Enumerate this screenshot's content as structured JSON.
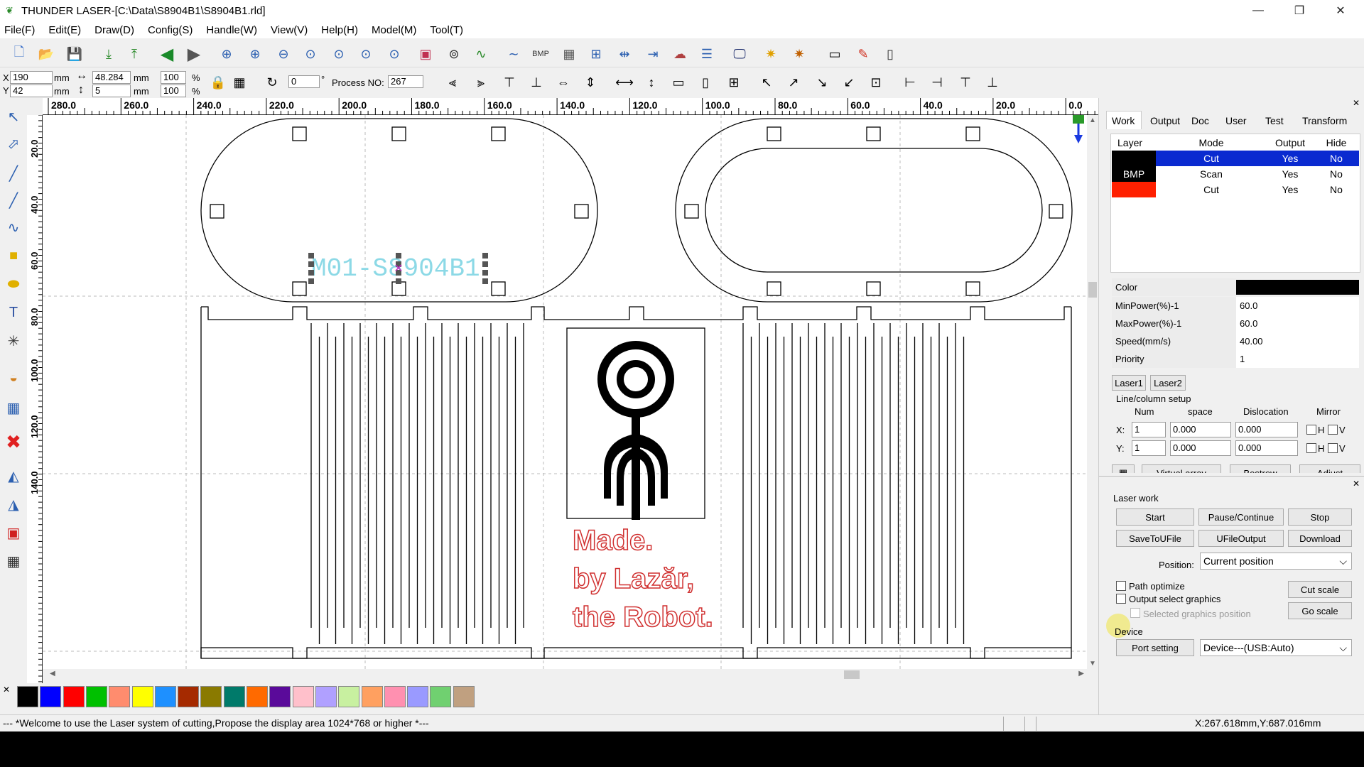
{
  "title": "THUNDER LASER-[C:\\Data\\S8904B1\\S8904B1.rld]",
  "menu": [
    "File(F)",
    "Edit(E)",
    "Draw(D)",
    "Config(S)",
    "Handle(W)",
    "View(V)",
    "Help(H)",
    "Model(M)",
    "Tool(T)"
  ],
  "coords": {
    "x_label": "X",
    "x_val": "190",
    "y_label": "Y",
    "y_val": "42",
    "unit": "mm",
    "w_val": "48.284",
    "h_val": "5",
    "pct_w": "100",
    "pct_h": "100",
    "pct": "%",
    "angle": "0",
    "deg": "°",
    "process_label": "Process NO:",
    "process_no": "267"
  },
  "hruler": [
    "280.0",
    "260.0",
    "240.0",
    "220.0",
    "200.0",
    "180.0",
    "160.0",
    "140.0",
    "120.0",
    "100.0",
    "80.0",
    "60.0",
    "40.0",
    "20.0",
    "0.0"
  ],
  "vruler": [
    "20.0",
    "40.0",
    "60.0",
    "80.0",
    "100.0",
    "120.0",
    "140.0"
  ],
  "canvas": {
    "label_text": "M01-S8904B1",
    "made_text": [
      "Made.",
      "by Lazăr,",
      "the Robot."
    ]
  },
  "palette_colors": [
    "#000000",
    "#0000ff",
    "#ff0000",
    "#00c000",
    "#ff8c6e",
    "#ffff00",
    "#1e90ff",
    "#a52a00",
    "#8a7a00",
    "#007a6a",
    "#ff6a00",
    "#5a0a9a",
    "#ffc0cb",
    "#b0a0ff",
    "#c8f0a0",
    "#ffa060",
    "#ff90b0",
    "#9a9aff",
    "#70d070",
    "#c0a080"
  ],
  "status": {
    "message": "--- *Welcome to use the Laser system of cutting,Propose the display area 1024*768 or higher *---",
    "coords": "X:267.618mm,Y:687.016mm"
  },
  "panel": {
    "tabs": [
      "Work",
      "Output",
      "Doc",
      "User",
      "Test",
      "Transform"
    ],
    "layer_headers": [
      "Layer",
      "Mode",
      "Output",
      "Hide"
    ],
    "layers": [
      {
        "name": "",
        "color": "#000000",
        "mode": "Cut",
        "output": "Yes",
        "hide": "No",
        "selected": true
      },
      {
        "name": "BMP",
        "color": "#000000",
        "mode": "Scan",
        "output": "Yes",
        "hide": "No",
        "selected": false
      },
      {
        "name": "",
        "color": "#ff2000",
        "mode": "Cut",
        "output": "Yes",
        "hide": "No",
        "selected": false
      }
    ],
    "props": [
      {
        "k": "Color",
        "v": ""
      },
      {
        "k": "MinPower(%)-1",
        "v": "60.0"
      },
      {
        "k": "MaxPower(%)-1",
        "v": "60.0"
      },
      {
        "k": "Speed(mm/s)",
        "v": "40.00"
      },
      {
        "k": "Priority",
        "v": "1"
      }
    ],
    "laser_tabs": [
      "Laser1",
      "Laser2"
    ],
    "line_setup": "Line/column setup",
    "grid_headers": [
      "Num",
      "space",
      "Dislocation",
      "Mirror"
    ],
    "gx": {
      "label": "X:",
      "num": "1",
      "space": "0.000",
      "disl": "0.000",
      "h": "H",
      "v": "V"
    },
    "gy": {
      "label": "Y:",
      "num": "1",
      "space": "0.000",
      "disl": "0.000",
      "h": "H",
      "v": "V"
    },
    "array_btns": [
      "Virtual array",
      "Bestrew",
      "Adjust"
    ],
    "laser_work": "Laser work",
    "btn_start": "Start",
    "btn_pause": "Pause/Continue",
    "btn_stop": "Stop",
    "btn_save": "SaveToUFile",
    "btn_ufile": "UFileOutput",
    "btn_download": "Download",
    "position_label": "Position:",
    "position_val": "Current position",
    "path_opt": "Path optimize",
    "output_sel": "Output select graphics",
    "sel_pos": "Selected graphics position",
    "cut_scale": "Cut scale",
    "go_scale": "Go scale",
    "device_label": "Device",
    "port_setting": "Port setting",
    "device_val": "Device---(USB:Auto)"
  }
}
